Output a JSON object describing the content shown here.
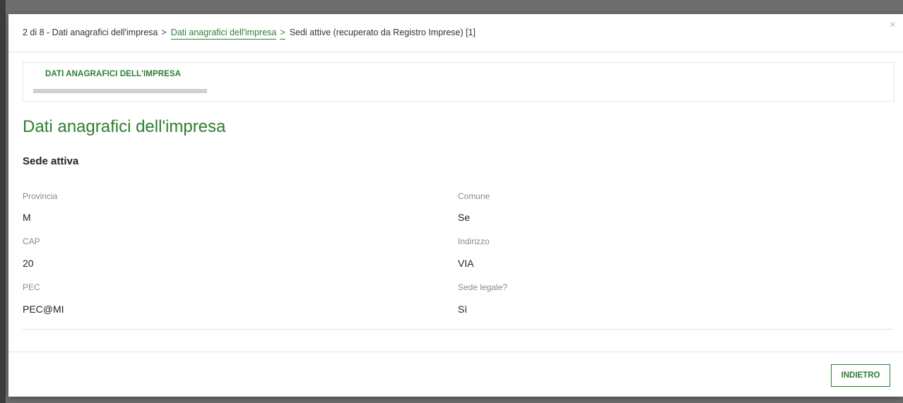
{
  "breadcrumb": {
    "step": "2 di 8 - Dati anagrafici dell'impresa",
    "separator": ">",
    "link": "Dati anagrafici dell'impresa",
    "current": "Sedi attive (recuperato da Registro Imprese) [1]"
  },
  "close_glyph": "×",
  "step_header": {
    "title": "DATI ANAGRAFICI DELL'IMPRESA",
    "progress": 1.0
  },
  "page_title": "Dati anagrafici dell'impresa",
  "section_title": "Sede attiva",
  "fields": {
    "provincia": {
      "label": "Provincia",
      "value": "M"
    },
    "comune": {
      "label": "Comune",
      "value": "Se"
    },
    "cap": {
      "label": "CAP",
      "value": "20"
    },
    "indirizzo": {
      "label": "Indirizzo",
      "value": "VIA"
    },
    "pec": {
      "label": "PEC",
      "value": "PEC@MI"
    },
    "sede_legale": {
      "label": "Sede legale?",
      "value": "Sì"
    }
  },
  "footer": {
    "back_label": "INDIETRO"
  },
  "colors": {
    "accent": "#2e7d32",
    "label": "#8a8a8a",
    "text": "#222222"
  }
}
